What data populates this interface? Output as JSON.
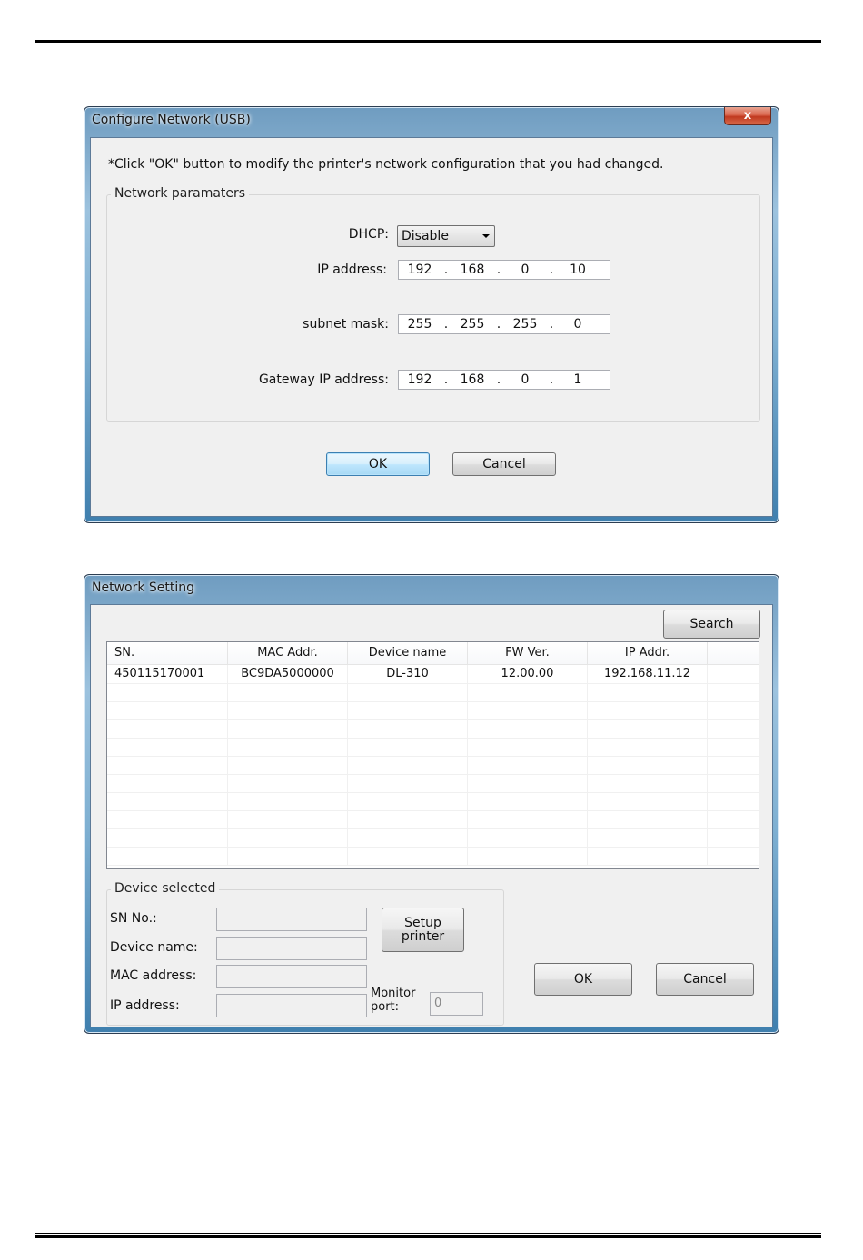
{
  "dialog1": {
    "title": "Configure Network (USB)",
    "close_label": "x",
    "instruction": "*Click \"OK\" button to modify the printer's network configuration that you had changed.",
    "group_label": "Network paramaters",
    "dhcp": {
      "label": "DHCP:",
      "value": "Disable"
    },
    "ip_address": {
      "label": "IP address:",
      "octets": [
        "192",
        "168",
        "0",
        "10"
      ]
    },
    "subnet_mask": {
      "label": "subnet mask:",
      "octets": [
        "255",
        "255",
        "255",
        "0"
      ]
    },
    "gateway": {
      "label": "Gateway IP address:",
      "octets": [
        "192",
        "168",
        "0",
        "1"
      ]
    },
    "ok_label": "OK",
    "cancel_label": "Cancel"
  },
  "dialog2": {
    "title": "Network Setting",
    "search_label": "Search",
    "table": {
      "columns": [
        "SN.",
        "MAC Addr.",
        "Device name",
        "FW Ver.",
        "IP Addr."
      ],
      "rows": [
        [
          "450115170001",
          "BC9DA5000000",
          "DL-310",
          "12.00.00",
          "192.168.11.12"
        ]
      ]
    },
    "device_selected": {
      "group_label": "Device selected",
      "sn_label": "SN No.:",
      "device_name_label": "Device name:",
      "mac_label": "MAC address:",
      "ip_label": "IP address:",
      "setup_printer_label": "Setup printer",
      "monitor_port_label": "Monitor port:",
      "monitor_port_value": "0"
    },
    "ok_label": "OK",
    "cancel_label": "Cancel"
  }
}
